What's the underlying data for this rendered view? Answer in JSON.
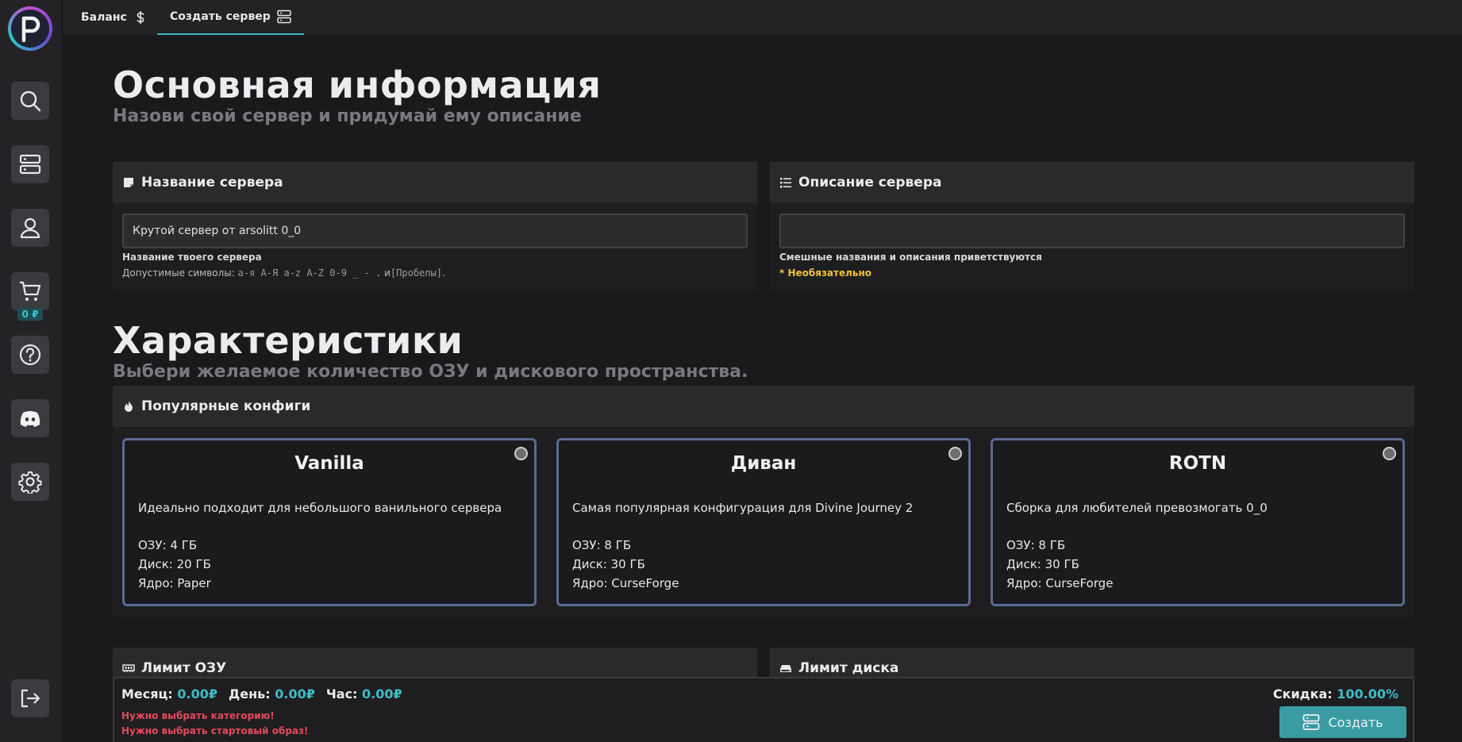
{
  "sidebar": {
    "logo_letter": "P",
    "cart_price": "0 ₽"
  },
  "topbar": {
    "tabs": [
      {
        "label": "Баланс"
      },
      {
        "label": "Создать сервер"
      }
    ]
  },
  "basic": {
    "title": "Основная информация",
    "subtitle": "Назови свой сервер и придумай ему описание",
    "name_panel": {
      "header": "Название сервера",
      "value": "Крутой сервер от arsolitt 0_0",
      "hint": "Название твоего сервера",
      "allowed_prefix": "Допустимые символы:",
      "allowed_chars": "а-я А-Я a-z A-Z 0-9 _ - .",
      "allowed_and": "и",
      "allowed_spaces": "[Пробелы]",
      "allowed_end": "."
    },
    "desc_panel": {
      "header": "Описание сервера",
      "value": "",
      "hint": "Смешные названия и описания приветствуются",
      "optional": "* Необязательно"
    }
  },
  "specs": {
    "title": "Характеристики",
    "subtitle": "Выбери желаемое количество ОЗУ и дискового пространства.",
    "popular_header": "Популярные конфиги",
    "configs": [
      {
        "title": "Vanilla",
        "desc": "Идеально подходит для небольшого ванильного сервера",
        "ram": "ОЗУ: 4 ГБ",
        "disk": "Диск: 20 ГБ",
        "core": "Ядро: Paper"
      },
      {
        "title": "Диван",
        "desc": "Самая популярная конфигурация для Divine Journey 2",
        "ram": "ОЗУ: 8 ГБ",
        "disk": "Диск: 30 ГБ",
        "core": "Ядро: CurseForge"
      },
      {
        "title": "ROTN",
        "desc": "Сборка для любителей превозмогать 0_0",
        "ram": "ОЗУ: 8 ГБ",
        "disk": "Диск: 30 ГБ",
        "core": "Ядро: CurseForge"
      }
    ],
    "ram_limit_header": "Лимит ОЗУ",
    "disk_limit_header": "Лимит диска"
  },
  "summary": {
    "month_label": "Месяц:",
    "month_value": "0.00₽",
    "day_label": "День:",
    "day_value": "0.00₽",
    "hour_label": "Час:",
    "hour_value": "0.00₽",
    "error_category": "Нужно выбрать категорию!",
    "error_image": "Нужно выбрать стартовый образ!",
    "discount_label": "Скидка:",
    "discount_value": "100.00%",
    "create_label": "Создать"
  },
  "colors": {
    "accent": "#3fbcc6",
    "error": "#e24a5c",
    "optional": "#f0c23c",
    "card_border": "#5a6a93",
    "button": "#3a9ba3"
  }
}
